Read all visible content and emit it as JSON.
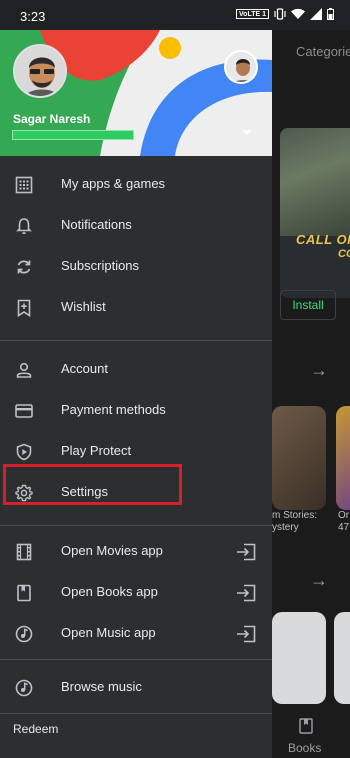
{
  "status_bar": {
    "time": "3:23",
    "volte": "VoLTE 1"
  },
  "background": {
    "tab": "Categorie",
    "game_title_line1": "CALL OF D",
    "game_title_line2": "CO",
    "install_label": "Install",
    "card1_caption_line1": "m Stories:",
    "card1_caption_line2": "ystery",
    "card2_caption_line1": "Or",
    "card2_caption_line2": "47",
    "nav_books_label": "Books"
  },
  "drawer": {
    "user_name": "Sagar Naresh",
    "sections": [
      [
        {
          "label": "My apps & games",
          "icon": "apps-grid-icon"
        },
        {
          "label": "Notifications",
          "icon": "bell-icon"
        },
        {
          "label": "Subscriptions",
          "icon": "refresh-icon"
        },
        {
          "label": "Wishlist",
          "icon": "bookmark-add-icon"
        }
      ],
      [
        {
          "label": "Account",
          "icon": "person-icon"
        },
        {
          "label": "Payment methods",
          "icon": "credit-card-icon"
        },
        {
          "label": "Play Protect",
          "icon": "shield-play-icon"
        },
        {
          "label": "Settings",
          "icon": "gear-icon"
        }
      ],
      [
        {
          "label": "Open Movies app",
          "icon": "film-icon"
        },
        {
          "label": "Open Books app",
          "icon": "book-icon"
        },
        {
          "label": "Open Music app",
          "icon": "music-disc-icon"
        }
      ],
      [
        {
          "label": "Browse music",
          "icon": "music-disc-icon"
        }
      ]
    ],
    "redeem": "Redeem"
  }
}
